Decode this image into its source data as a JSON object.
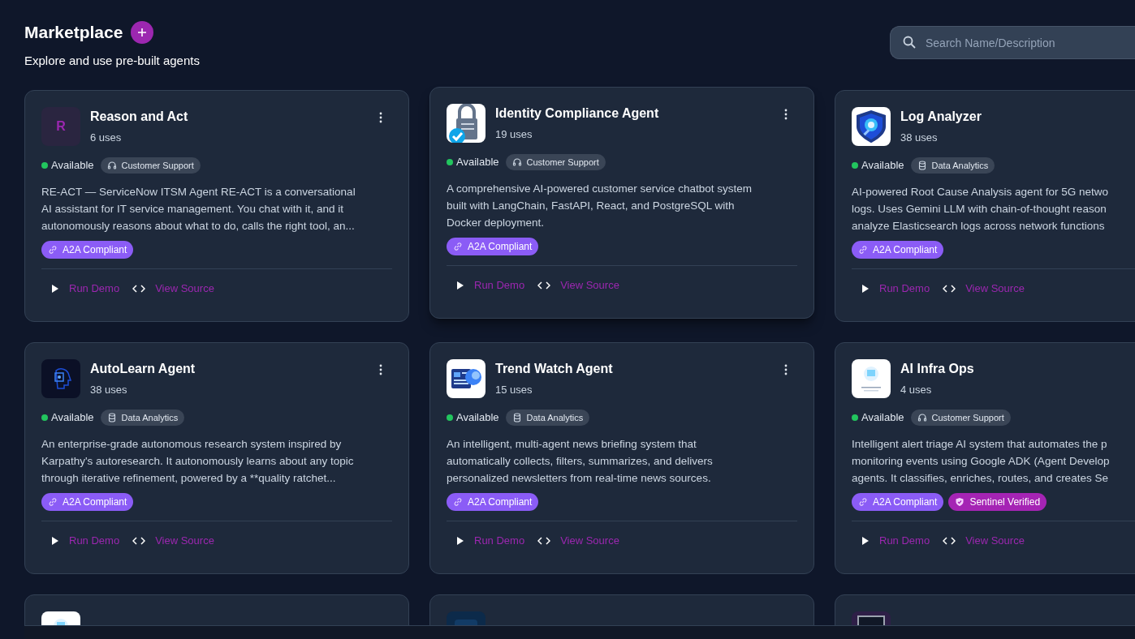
{
  "header": {
    "title": "Marketplace",
    "subtitle": "Explore and use pre-built agents"
  },
  "search": {
    "placeholder": "Search Name/Description"
  },
  "cards": [
    {
      "icon": {
        "kind": "letter",
        "letter": "R"
      },
      "title": "Reason and Act",
      "uses": "6 uses",
      "status": "Available",
      "category": {
        "kind": "support",
        "label": "Customer Support"
      },
      "description": [
        "RE-ACT — ServiceNow ITSM Agent RE-ACT is a conversational",
        "AI assistant for IT service management. You chat with it, and it",
        "autonomously reasons about what to do, calls the right tool, an..."
      ],
      "badges": [
        {
          "kind": "a2a",
          "label": "A2A Compliant"
        }
      ],
      "actions": [
        {
          "kind": "run",
          "label": "Run Demo"
        },
        {
          "kind": "source",
          "label": "View Source"
        }
      ],
      "raised": false
    },
    {
      "icon": {
        "kind": "picture"
      },
      "title": "Identity Compliance Agent",
      "uses": "19 uses",
      "status": "Available",
      "category": {
        "kind": "support",
        "label": "Customer Support"
      },
      "description": [
        "A comprehensive AI-powered customer service chatbot system",
        "built with LangChain, FastAPI, React, and PostgreSQL with",
        "Docker deployment."
      ],
      "badges": [
        {
          "kind": "a2a",
          "label": "A2A Compliant"
        }
      ],
      "actions": [
        {
          "kind": "run",
          "label": "Run Demo"
        },
        {
          "kind": "source",
          "label": "View Source"
        }
      ],
      "raised": true
    },
    {
      "icon": {
        "kind": "picture"
      },
      "title": "Log Analyzer",
      "uses": "38 uses",
      "status": "Available",
      "category": {
        "kind": "analytics",
        "label": "Data Analytics"
      },
      "description": [
        "AI-powered Root Cause Analysis agent for 5G netwo",
        "logs. Uses Gemini LLM with chain-of-thought reason",
        "analyze Elasticsearch logs across network functions"
      ],
      "badges": [
        {
          "kind": "a2a",
          "label": "A2A Compliant"
        }
      ],
      "actions": [
        {
          "kind": "run",
          "label": "Run Demo"
        },
        {
          "kind": "source",
          "label": "View Source"
        }
      ],
      "raised": false
    },
    {
      "icon": {
        "kind": "picture"
      },
      "title": "AutoLearn Agent",
      "uses": "38 uses",
      "status": "Available",
      "category": {
        "kind": "analytics",
        "label": "Data Analytics"
      },
      "description": [
        "An enterprise-grade autonomous research system inspired by",
        "Karpathy's autoresearch. It autonomously learns about any topic",
        "through iterative refinement, powered by a **quality ratchet..."
      ],
      "badges": [
        {
          "kind": "a2a",
          "label": "A2A Compliant"
        }
      ],
      "actions": [
        {
          "kind": "run",
          "label": "Run Demo"
        },
        {
          "kind": "source",
          "label": "View Source"
        }
      ],
      "raised": false
    },
    {
      "icon": {
        "kind": "picture"
      },
      "title": "Trend Watch Agent",
      "uses": "15 uses",
      "status": "Available",
      "category": {
        "kind": "analytics",
        "label": "Data Analytics"
      },
      "description": [
        "An intelligent, multi-agent news briefing system that",
        "automatically collects, filters, summarizes, and delivers",
        "personalized newsletters from real-time news sources."
      ],
      "badges": [
        {
          "kind": "a2a",
          "label": "A2A Compliant"
        }
      ],
      "actions": [
        {
          "kind": "run",
          "label": "Run Demo"
        },
        {
          "kind": "source",
          "label": "View Source"
        }
      ],
      "raised": false
    },
    {
      "icon": {
        "kind": "picture"
      },
      "title": "AI Infra Ops",
      "uses": "4 uses",
      "status": "Available",
      "category": {
        "kind": "support",
        "label": "Customer Support"
      },
      "description": [
        "Intelligent alert triage AI system that automates the p",
        "monitoring events using Google ADK (Agent Develop",
        "agents. It classifies, enriches, routes, and creates Se"
      ],
      "badges": [
        {
          "kind": "a2a",
          "label": "A2A Compliant"
        },
        {
          "kind": "sentinel",
          "label": "Sentinel Verified"
        }
      ],
      "actions": [
        {
          "kind": "run",
          "label": "Run Demo"
        },
        {
          "kind": "source",
          "label": "View Source"
        }
      ],
      "raised": false
    }
  ],
  "partial_cards": [
    {
      "icon": {
        "kind": "picture"
      }
    },
    {
      "icon": {
        "kind": "picture"
      }
    },
    {
      "icon": {
        "kind": "picture"
      }
    }
  ]
}
